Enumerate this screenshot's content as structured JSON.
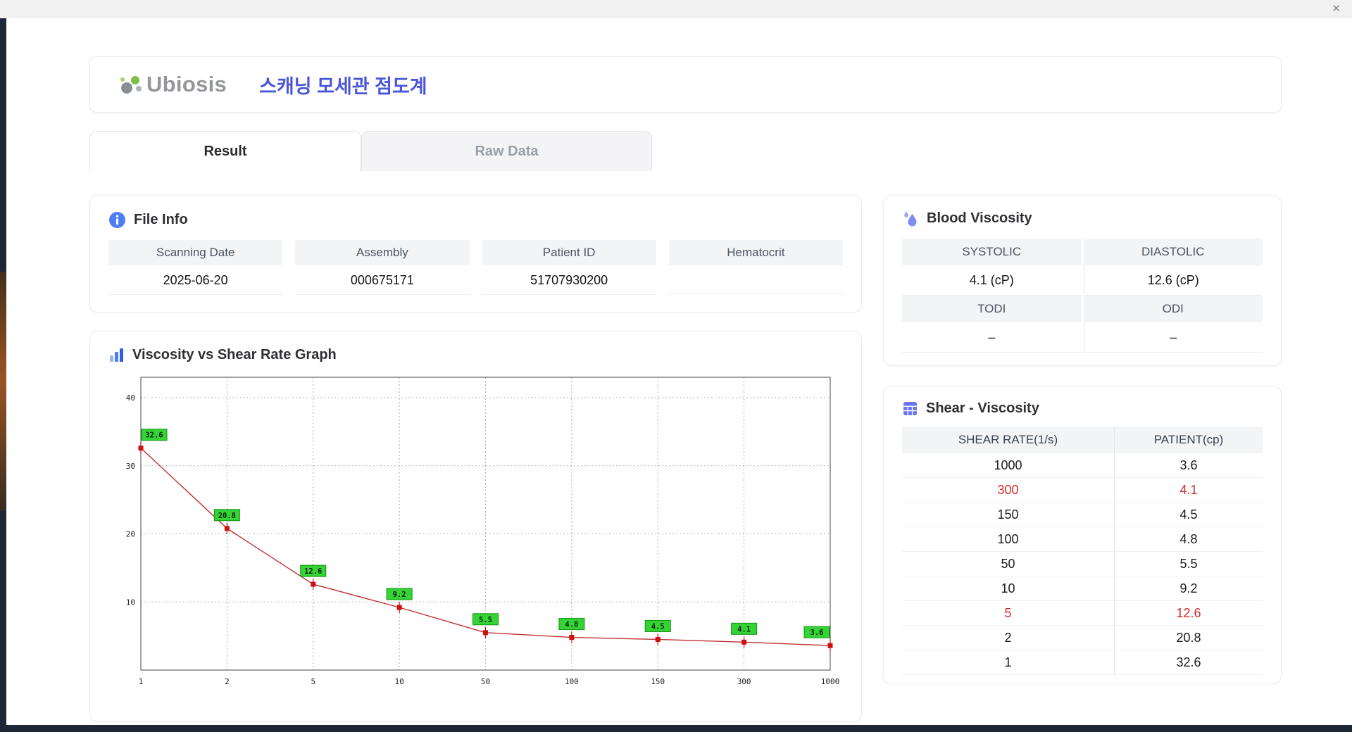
{
  "window": {
    "close_label": "✕"
  },
  "header": {
    "logo_text": "Ubiosis",
    "app_title": "스캐닝 모세관 점도계"
  },
  "tabs": [
    {
      "id": "result",
      "label": "Result",
      "active": true
    },
    {
      "id": "raw-data",
      "label": "Raw Data",
      "active": false
    }
  ],
  "file_info": {
    "title": "File Info",
    "fields": [
      {
        "label": "Scanning Date",
        "value": "2025-06-20"
      },
      {
        "label": "Assembly",
        "value": "000675171"
      },
      {
        "label": "Patient ID",
        "value": "51707930200"
      },
      {
        "label": "Hematocrit",
        "value": ""
      }
    ]
  },
  "graph_section": {
    "title": "Viscosity vs Shear Rate Graph"
  },
  "blood_viscosity": {
    "title": "Blood Viscosity",
    "rows": [
      [
        {
          "label": "SYSTOLIC",
          "value": "4.1 (cP)"
        },
        {
          "label": "DIASTOLIC",
          "value": "12.6 (cP)"
        }
      ],
      [
        {
          "label": "TODI",
          "value": "–"
        },
        {
          "label": "ODI",
          "value": "–"
        }
      ]
    ]
  },
  "shear_viscosity": {
    "title": "Shear - Viscosity",
    "columns": [
      "SHEAR RATE(1/s)",
      "PATIENT(cp)"
    ],
    "rows": [
      {
        "shear_rate": "1000",
        "patient": "3.6",
        "highlight": false
      },
      {
        "shear_rate": "300",
        "patient": "4.1",
        "highlight": true
      },
      {
        "shear_rate": "150",
        "patient": "4.5",
        "highlight": false
      },
      {
        "shear_rate": "100",
        "patient": "4.8",
        "highlight": false
      },
      {
        "shear_rate": "50",
        "patient": "5.5",
        "highlight": false
      },
      {
        "shear_rate": "10",
        "patient": "9.2",
        "highlight": false
      },
      {
        "shear_rate": "5",
        "patient": "12.6",
        "highlight": true
      },
      {
        "shear_rate": "2",
        "patient": "20.8",
        "highlight": false
      },
      {
        "shear_rate": "1",
        "patient": "32.6",
        "highlight": false
      }
    ]
  },
  "chart_data": {
    "type": "line",
    "title": "Viscosity vs Shear Rate Graph",
    "x_categories": [
      "1",
      "2",
      "5",
      "10",
      "50",
      "100",
      "150",
      "300",
      "1000"
    ],
    "values": [
      32.6,
      20.8,
      12.6,
      9.2,
      5.5,
      4.8,
      4.5,
      4.1,
      3.6
    ],
    "point_labels": [
      "32.6",
      "20.8",
      "12.6",
      "9.2",
      "5.5",
      "4.8",
      "4.5",
      "4.1",
      "3.6"
    ],
    "xlabel": "",
    "ylabel": "",
    "ylim": [
      0,
      43
    ],
    "yticks": [
      10,
      20,
      30,
      40
    ],
    "x_axis_note": "shear-rate categories equally spaced (log-like scale)",
    "grid": true,
    "legend": "none",
    "colors": {
      "line": "#c03030",
      "marker": "#cc1111",
      "label_bg": "#35d435",
      "label_border": "#149014"
    }
  },
  "colors": {
    "accent_title": "#4b55d8",
    "highlight_red": "#d22b2b",
    "header_bg": "#f3f4f6"
  }
}
